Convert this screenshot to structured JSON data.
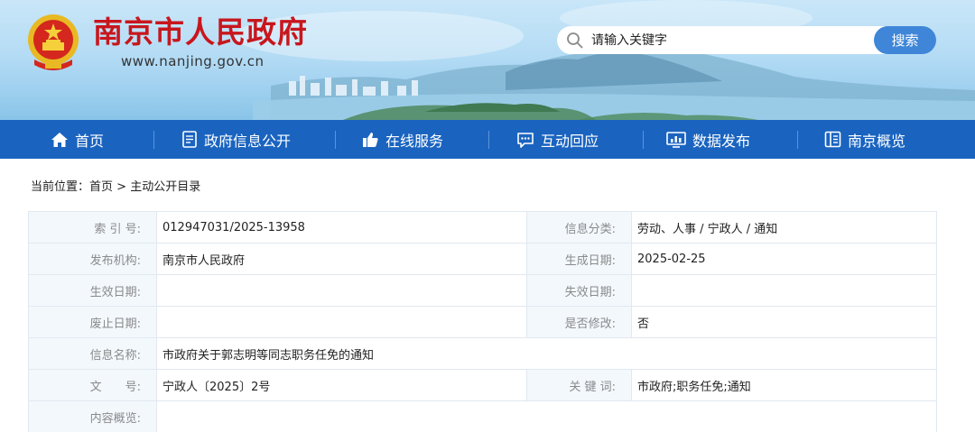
{
  "header": {
    "site_title": "南京市人民政府",
    "site_url": "www.nanjing.gov.cn",
    "search": {
      "placeholder": "请输入关键字",
      "button_label": "搜索"
    }
  },
  "nav": {
    "items": [
      {
        "label": "首页",
        "icon": "home-icon"
      },
      {
        "label": "政府信息公开",
        "icon": "document-icon"
      },
      {
        "label": "在线服务",
        "icon": "thumbs-up-icon"
      },
      {
        "label": "互动回应",
        "icon": "chat-icon"
      },
      {
        "label": "数据发布",
        "icon": "chart-icon"
      },
      {
        "label": "南京概览",
        "icon": "book-icon"
      }
    ]
  },
  "breadcrumb": {
    "prefix": "当前位置：",
    "home": "首页",
    "separator": ">",
    "current": "主动公开目录"
  },
  "info": {
    "index_no": {
      "label": "索 引 号:",
      "value": "012947031/2025-13958"
    },
    "category": {
      "label": "信息分类:",
      "value": "劳动、人事 / 宁政人 / 通知"
    },
    "publisher": {
      "label": "发布机构:",
      "value": "南京市人民政府"
    },
    "created": {
      "label": "生成日期:",
      "value": "2025-02-25"
    },
    "effective": {
      "label": "生效日期:",
      "value": ""
    },
    "expiry": {
      "label": "失效日期:",
      "value": ""
    },
    "repealed": {
      "label": "废止日期:",
      "value": ""
    },
    "modified": {
      "label": "是否修改:",
      "value": "否"
    },
    "name": {
      "label": "信息名称:",
      "value": "市政府关于郭志明等同志职务任免的通知"
    },
    "doc_no": {
      "label": "文　　号:",
      "value": "宁政人〔2025〕2号"
    },
    "keywords": {
      "label": "关 键 词:",
      "value": "市政府;职务任免;通知"
    },
    "summary": {
      "label": "内容概览:",
      "value": ""
    }
  },
  "colors": {
    "brand_red": "#c8161d",
    "nav_blue": "#1a64c0",
    "search_button": "#3f86d8",
    "label_bg": "#f3f8fd"
  }
}
